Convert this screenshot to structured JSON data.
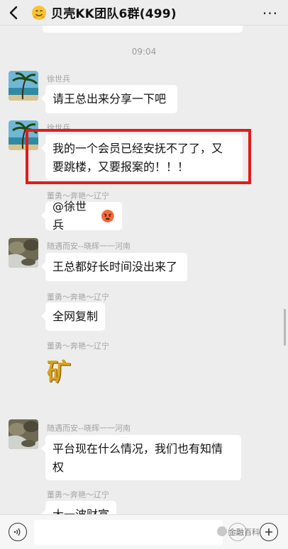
{
  "header": {
    "title": "贝壳KK团队6群(499)",
    "emoji_icon": "smiling-face-emoji-icon",
    "back_icon": "chevron-left-icon",
    "more_icon": "ellipsis-icon",
    "more_glyph": "···"
  },
  "timestamp": "09:04",
  "messages": [
    {
      "sender": "徐世兵",
      "lines": [
        "请王总出来分享一下吧"
      ],
      "avatar": "palm-beach-avatar"
    },
    {
      "sender": "徐世兵",
      "lines": [
        "我的一个会员已经安抚不了了，又",
        "要跳楼，又要报案的！！！"
      ],
      "avatar": "palm-beach-avatar",
      "highlighted": true
    },
    {
      "sender": "董勇～奔艳～辽宁",
      "lines": [
        "@徐世兵"
      ],
      "emoji": "angry-face-emoji"
    },
    {
      "sender": "随遇而安--晓辉一一河南",
      "lines": [
        "王总都好长时间没出来了"
      ],
      "avatar": "rocky-stream-avatar"
    },
    {
      "sender": "董勇～奔艳～辽宁",
      "lines": [
        "全网复制"
      ]
    },
    {
      "sender": "董勇～奔艳～辽宁",
      "sticker": "矿"
    },
    {
      "sender": "随遇而安--晓辉一一河南",
      "lines": [
        "平台现在什么情况，我们也有知情",
        "权"
      ],
      "avatar": "rocky-stream-avatar"
    },
    {
      "sender": "董勇～奔艳～辽宁",
      "lines": [
        "大一波财富"
      ],
      "partial": true
    }
  ],
  "input_bar": {
    "voice_icon": "voice-icon",
    "emoji_icon": "emoji-icon",
    "plus_icon": "plus-icon",
    "watermark": "金融百科"
  },
  "colors": {
    "highlight_box": "#e21b1b",
    "bubble": "#ffffff",
    "background": "#ededed"
  }
}
